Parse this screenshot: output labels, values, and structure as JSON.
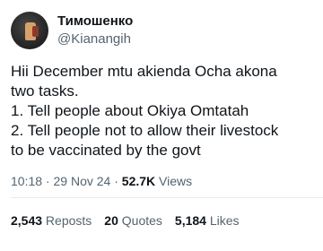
{
  "author": {
    "display_name": "Тимошенко",
    "handle": "@Kianangih"
  },
  "tweet": {
    "lines": [
      "Hii December mtu akienda Ocha akona",
      "two tasks.",
      "1. Tell people about Okiya Omtatah",
      "2. Tell people not to allow their livestock",
      "to be vaccinated by the govt"
    ]
  },
  "meta": {
    "time": "10:18",
    "sep1": " · ",
    "date": "29 Nov 24",
    "sep2": " · ",
    "views_count": "52.7K",
    "views_label": " Views"
  },
  "stats": {
    "reposts_count": "2,543",
    "reposts_label": " Reposts",
    "quotes_count": "20",
    "quotes_label": " Quotes",
    "likes_count": "5,184",
    "likes_label": " Likes"
  },
  "colors": {
    "text": "#0f1419",
    "muted": "#536471",
    "divider": "#e6ecf0"
  }
}
